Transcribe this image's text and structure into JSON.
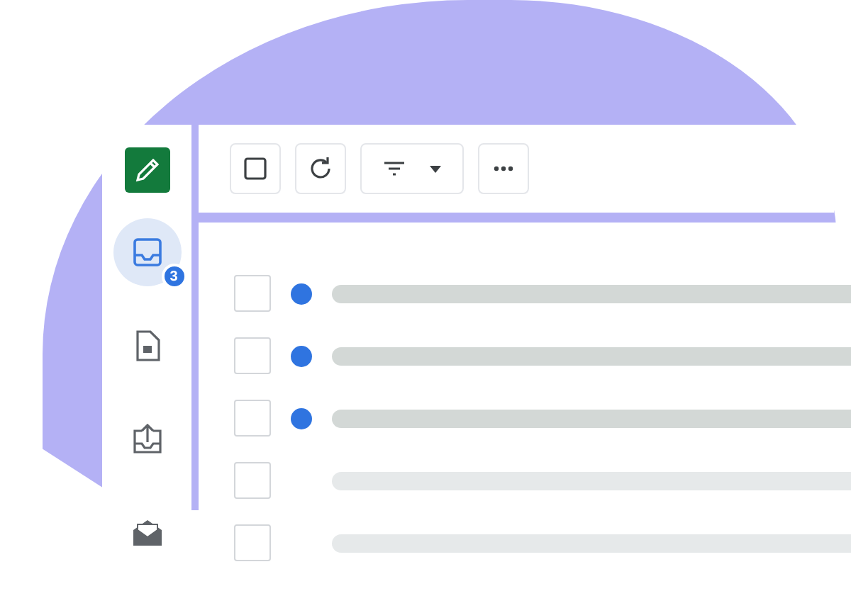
{
  "sidebar": {
    "compose": {
      "selected": false
    },
    "items": [
      {
        "kind": "inbox",
        "selected": true,
        "badge": "3"
      },
      {
        "kind": "drafts",
        "selected": false
      },
      {
        "kind": "sent",
        "selected": false
      },
      {
        "kind": "archive",
        "selected": false
      }
    ]
  },
  "messages": [
    {
      "checked": false,
      "unread": true
    },
    {
      "checked": false,
      "unread": true
    },
    {
      "checked": false,
      "unread": true
    },
    {
      "checked": false,
      "unread": false
    },
    {
      "checked": false,
      "unread": false
    }
  ]
}
